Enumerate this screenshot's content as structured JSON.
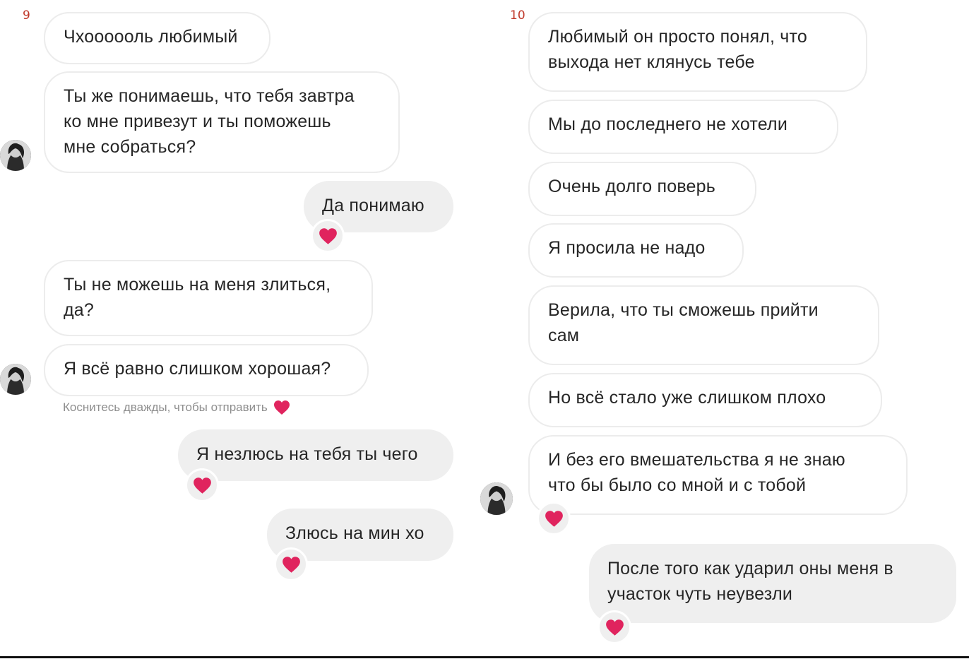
{
  "pages": [
    {
      "number": "9",
      "messages": [
        {
          "id": "m1",
          "text": "Чхоооооль любимый"
        },
        {
          "id": "m2",
          "lines": [
            "Ты же понимаешь, что тебя завтра",
            "ко мне привезут и ты поможешь",
            "мне собраться?"
          ]
        },
        {
          "id": "m3",
          "text": "Да понимаю",
          "reaction": "heart-icon"
        },
        {
          "id": "m4",
          "lines": [
            "Ты не можешь на меня злиться,",
            "да?"
          ]
        },
        {
          "id": "m5",
          "text": "Я всё равно слишком хорошая?"
        },
        {
          "id": "m6",
          "text": "Я незлюсь на тебя ты чего",
          "reaction": "heart-icon"
        },
        {
          "id": "m7",
          "text": "Злюсь на мин хо",
          "reaction": "heart-icon"
        }
      ],
      "hint": "Коснитесь дважды, чтобы отправить"
    },
    {
      "number": "10",
      "messages": [
        {
          "id": "n1",
          "lines": [
            "Любимый он просто понял, что",
            "выхода нет клянусь тебе"
          ]
        },
        {
          "id": "n2",
          "text": "Мы до последнего не хотели"
        },
        {
          "id": "n3",
          "text": "Очень долго поверь"
        },
        {
          "id": "n4",
          "text": "Я просила не надо"
        },
        {
          "id": "n5",
          "lines": [
            "Верила, что ты сможешь прийти",
            "сам"
          ]
        },
        {
          "id": "n6",
          "text": "Но всё стало уже слишком плохо"
        },
        {
          "id": "n7",
          "lines": [
            "И без его вмешательства я не знаю",
            "что бы было со мной и с тобой"
          ],
          "reaction": "heart-icon"
        },
        {
          "id": "n8",
          "lines": [
            "После того как ударил оны меня в",
            "участок чуть неувезли"
          ],
          "reaction": "heart-icon"
        }
      ]
    }
  ],
  "colors": {
    "heart": "#e0245e",
    "page_number": "#c0392b",
    "outgoing_bubble": "#efefef",
    "incoming_border": "#ececec"
  }
}
